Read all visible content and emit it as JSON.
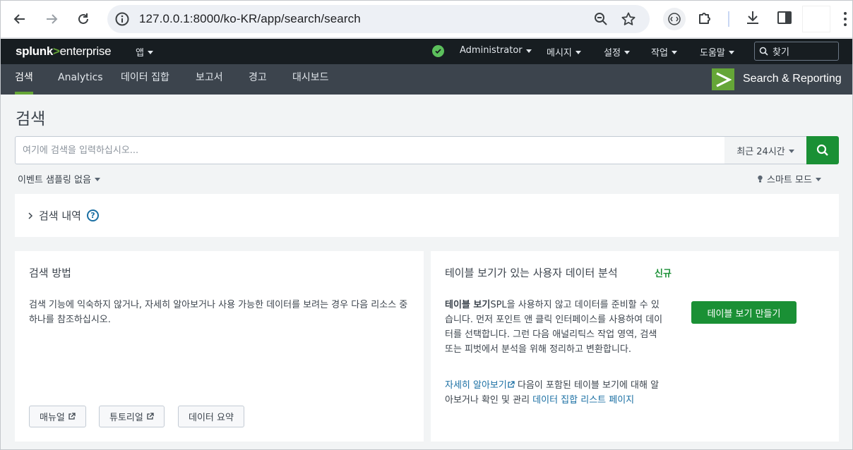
{
  "browser": {
    "url": "127.0.0.1:8000/ko-KR/app/search/search"
  },
  "splunk_bar": {
    "logo_main": "splunk",
    "logo_gt": ">",
    "logo_suffix": "enterprise",
    "apps_menu": "앱",
    "user_menu": "Administrator",
    "messages_menu": "메시지",
    "settings_menu": "설정",
    "activity_menu": "작업",
    "help_menu": "도움말",
    "find_label": "찾기",
    "status_color": "#5cc05c"
  },
  "app_nav": {
    "tabs": [
      {
        "label": "검색",
        "active": true
      },
      {
        "label": "Analytics",
        "active": false
      },
      {
        "label": "데이터 집합",
        "active": false
      },
      {
        "label": "보고서",
        "active": false
      },
      {
        "label": "경고",
        "active": false
      },
      {
        "label": "대시보드",
        "active": false
      }
    ],
    "app_name": "Search & Reporting",
    "accent_color": "#65a637"
  },
  "page": {
    "title": "검색",
    "search_placeholder": "여기에 검색을 입력하십시오...",
    "time_range": "최근 24시간",
    "sampling": "이벤트 샘플링 없음",
    "mode": "스마트 모드",
    "history_label": "검색 내역",
    "help_glyph": "?"
  },
  "how_to_search": {
    "title": "검색 방법",
    "text": "검색 기능에 익숙하지 않거나, 자세히 알아보거나 사용 가능한 데이터를 보려는 경우 다음 리소스 중 하나를 참조하십시오.",
    "buttons": {
      "manual": "매뉴얼",
      "tutorial": "튜토리얼",
      "data_summary": "데이터 요약"
    }
  },
  "table_views": {
    "title": "테이블 보기가 있는 사용자 데이터 분석",
    "new_badge": "신규",
    "text_bold": "테이블 보기",
    "text_rest": "SPL을 사용하지 않고 데이터를 준비할 수 있습니다. 먼저 포인트 앤 클릭 인터페이스를 사용하여 데이터를 선택합니다. 그런 다음 애널리틱스 작업 영역, 검색 또는 피벗에서 분석을 위해 정리하고 변환합니다.",
    "learn_more_link": "자세히 알아보기",
    "more_text": " 다음이 포함된 테이블 보기에 대해 알아보거나 확인 및 관리 ",
    "dataset_link": "데이터 집합 리스트 페이지",
    "create_button": "테이블 보기 만들기"
  }
}
